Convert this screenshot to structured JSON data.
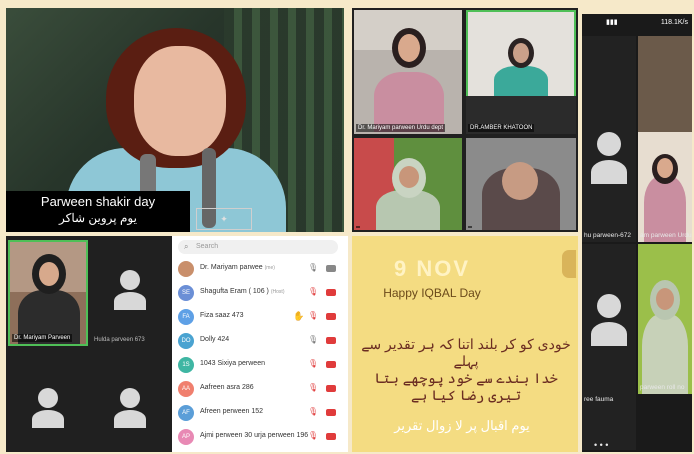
{
  "video": {
    "caption_en": "Parween shakir day",
    "caption_ur": "یوم پروین شاکر"
  },
  "meeting_grid": {
    "tiles": [
      {
        "name": "Dr. Mariyam parween Urdu dept"
      },
      {
        "name": "DR.AMBER KHATOON"
      },
      {
        "name": ""
      },
      {
        "name": ""
      }
    ]
  },
  "phone": {
    "status_right": "118.1K/s",
    "labels": [
      "hu parween-672",
      "am parween Urdu",
      "ree fauma",
      "parween roll no"
    ],
    "more": "• • •"
  },
  "participant_grid": {
    "tiles": [
      {
        "name": "Dr. Mariyam Parveen"
      },
      {
        "name": "Hulda parveen 673"
      },
      {
        "name": ""
      },
      {
        "name": ""
      }
    ]
  },
  "participant_list": {
    "search_placeholder": "Search",
    "rows": [
      {
        "initials": "",
        "name": "Dr. Mariyam parwee",
        "suffix": "(me)",
        "color": "#c98f6b",
        "hand": false,
        "mic": "on",
        "cam": "on"
      },
      {
        "initials": "SE",
        "name": "Shagufta Eram ( 106 )",
        "suffix": "(Host)",
        "color": "#6b8fd6",
        "hand": false,
        "mic": "off",
        "cam": "off"
      },
      {
        "initials": "FA",
        "name": "Fiza saaz 473",
        "suffix": "",
        "color": "#5ea0e6",
        "hand": true,
        "mic": "off",
        "cam": "off"
      },
      {
        "initials": "DO",
        "name": "Dolly 424",
        "suffix": "",
        "color": "#4aa3d1",
        "hand": false,
        "mic": "on",
        "cam": "off"
      },
      {
        "initials": "1S",
        "name": "1043 Sixiya perween",
        "suffix": "",
        "color": "#3fb6a3",
        "hand": false,
        "mic": "off",
        "cam": "off"
      },
      {
        "initials": "AA",
        "name": "Aafreen asra 286",
        "suffix": "",
        "color": "#f07f6e",
        "hand": false,
        "mic": "off",
        "cam": "off"
      },
      {
        "initials": "AF",
        "name": "Afreen perween 152",
        "suffix": "",
        "color": "#5b9ed8",
        "hand": false,
        "mic": "off",
        "cam": "off"
      },
      {
        "initials": "AP",
        "name": "Ajmi perween 30 urja perween 196",
        "suffix": "",
        "color": "#e889b4",
        "hand": false,
        "mic": "off",
        "cam": "off"
      }
    ]
  },
  "iqbal": {
    "date": "9 NOV",
    "title": "Happy IQBAL Day",
    "line1": "خودی کو کر بلند اتنا کہ ہر تقدیر سے پہلے",
    "line2": "خدا بندے سے خود پوچھے بتا تیری رضا کیا ہے",
    "line3": "یوم اقبال پر لا زوال تقریر"
  }
}
